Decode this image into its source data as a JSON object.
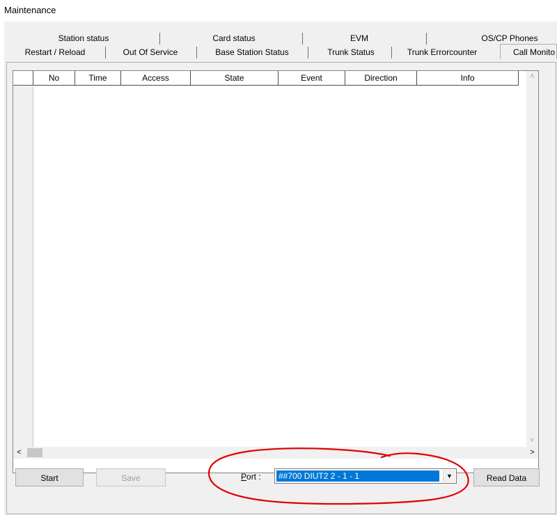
{
  "window": {
    "title": "Maintenance"
  },
  "tabs": {
    "row_back": [
      "Station status",
      "Card status",
      "EVM",
      "OS/CP Phones"
    ],
    "row_front": [
      "Restart / Reload",
      "Out Of Service",
      "Base Station Status",
      "Trunk Status",
      "Trunk Errorcounter",
      "Call Monito"
    ]
  },
  "grid": {
    "columns": [
      "No",
      "Time",
      "Access",
      "State",
      "Event",
      "Direction",
      "Info"
    ]
  },
  "buttons": {
    "start": "Start",
    "save": "Save",
    "read_data": "Read Data"
  },
  "port": {
    "label_hotkey": "P",
    "label_rest": "ort :",
    "selected": "##700  DIUT2  2 - 1 - 1"
  },
  "colors": {
    "selection": "#0078d7",
    "annotation": "#e00000"
  },
  "icons": {
    "scroll_up": "˄",
    "scroll_down": "˅",
    "scroll_left": "<",
    "scroll_right": ">",
    "dropdown": "▼"
  }
}
